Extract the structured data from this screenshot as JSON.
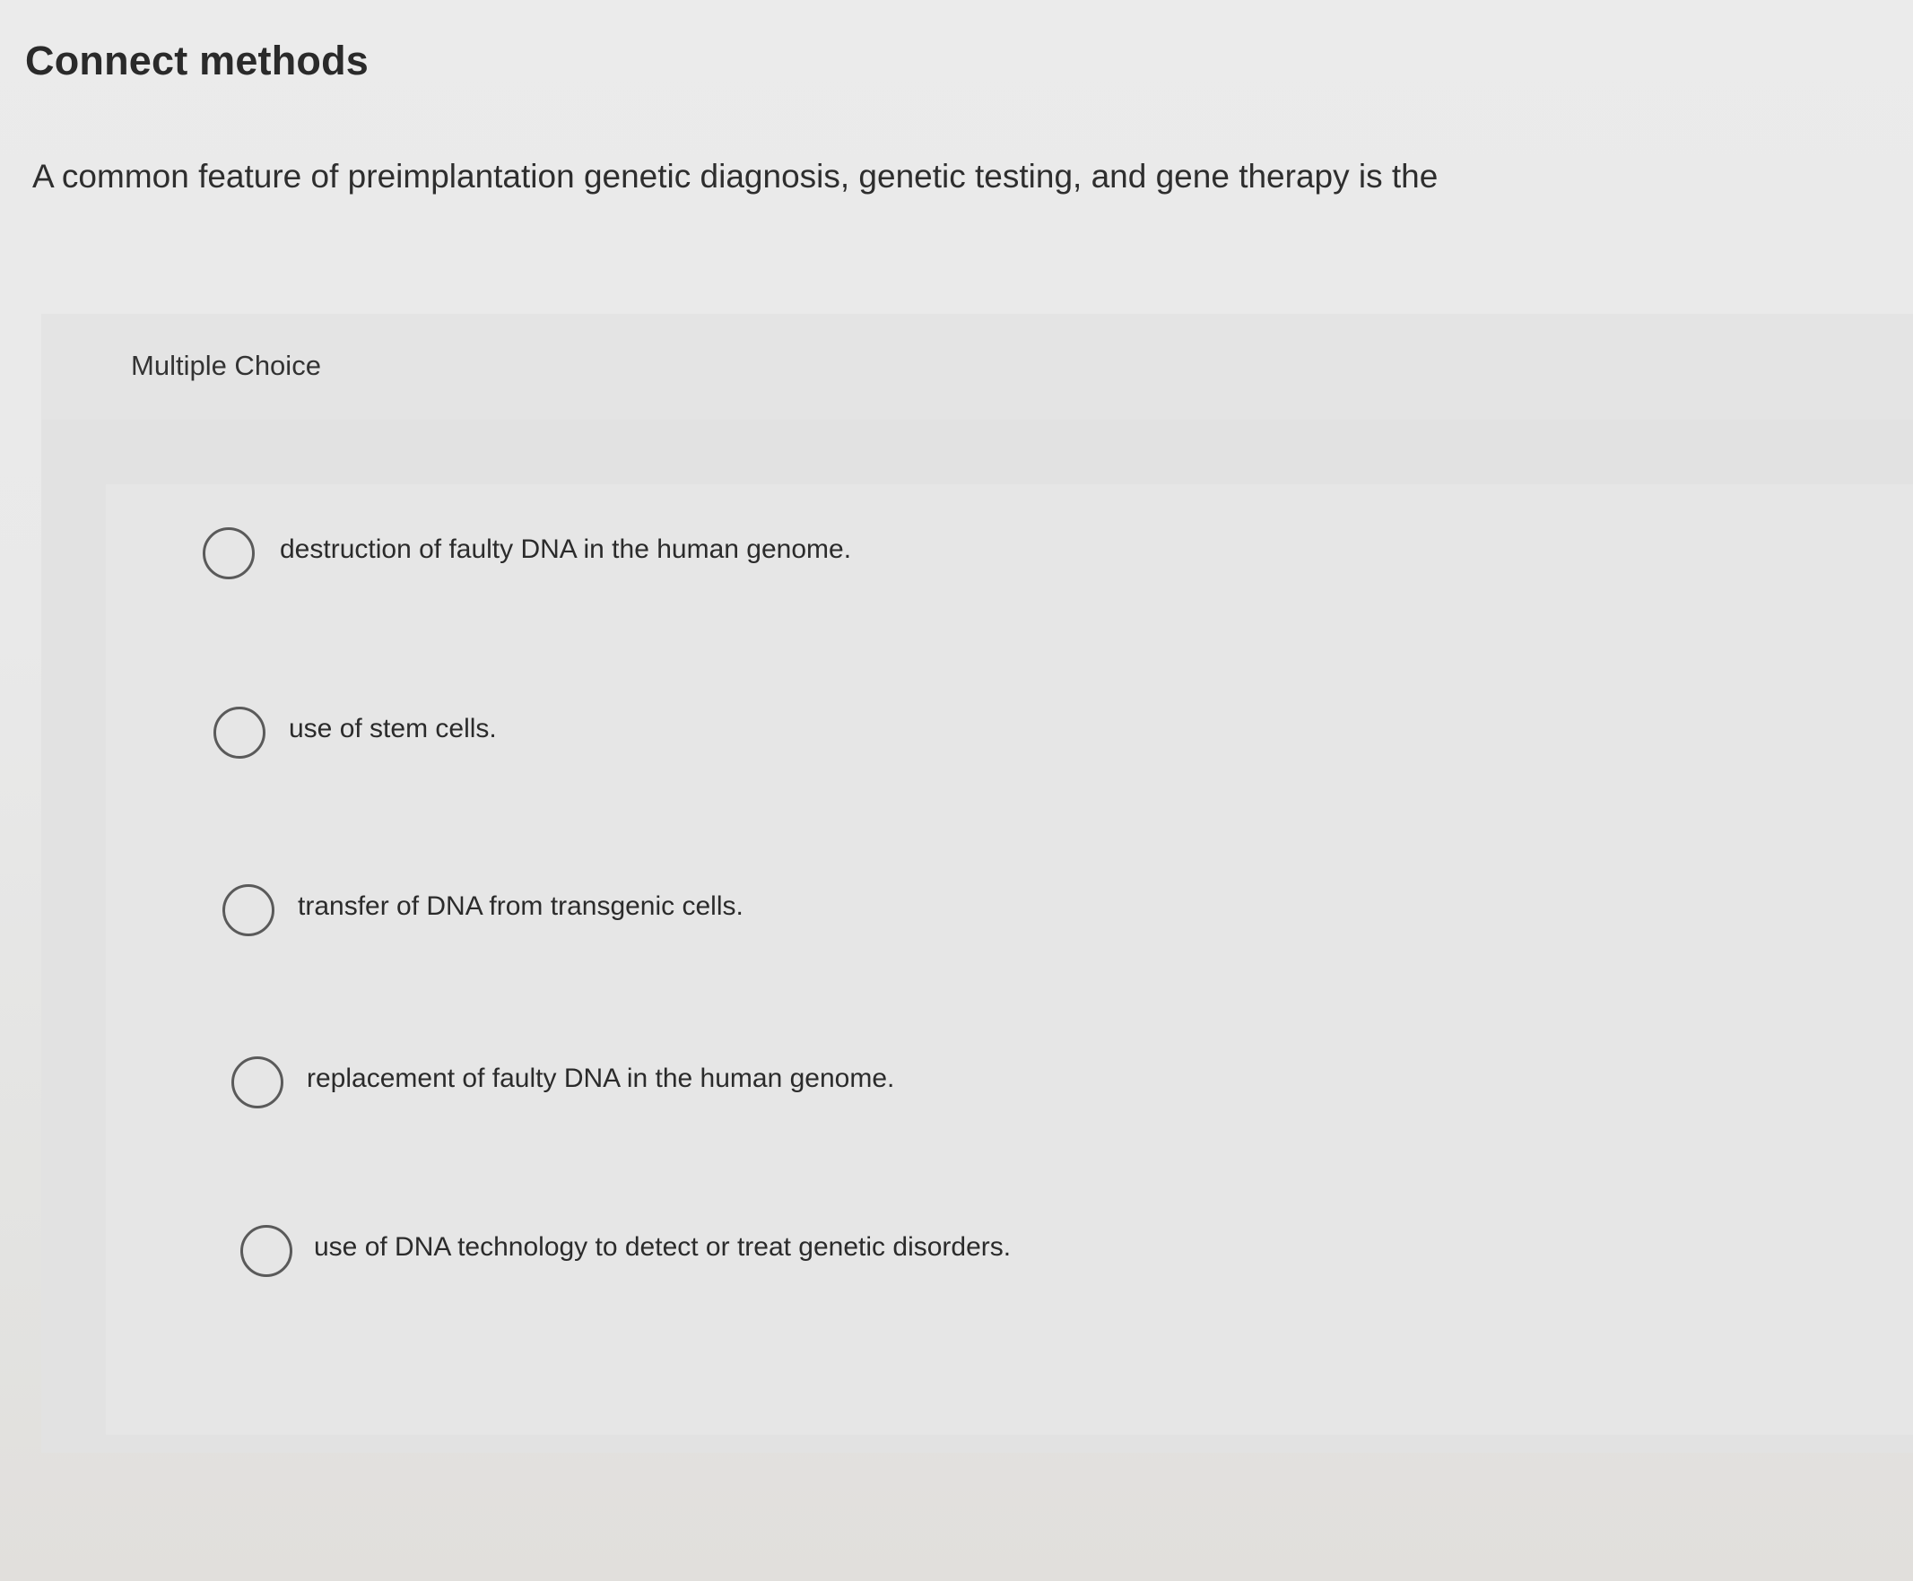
{
  "page": {
    "title": "Connect methods"
  },
  "question": {
    "text": "A common feature of preimplantation genetic diagnosis, genetic testing, and gene therapy is the",
    "type_label": "Multiple Choice"
  },
  "options": [
    {
      "label": "destruction of faulty DNA in the human genome.",
      "selected": false
    },
    {
      "label": "use of stem cells.",
      "selected": false
    },
    {
      "label": "transfer of DNA from transgenic cells.",
      "selected": false
    },
    {
      "label": "replacement of faulty DNA in the human genome.",
      "selected": false
    },
    {
      "label": "use of DNA technology to detect or treat genetic disorders.",
      "selected": false
    }
  ],
  "colors": {
    "background": "#ebebeb",
    "panel": "#e2e2e2",
    "text": "#2b2b2b",
    "radio_border": "#5a5a5a"
  },
  "icons": {
    "radio": "radio-unselected-icon"
  }
}
